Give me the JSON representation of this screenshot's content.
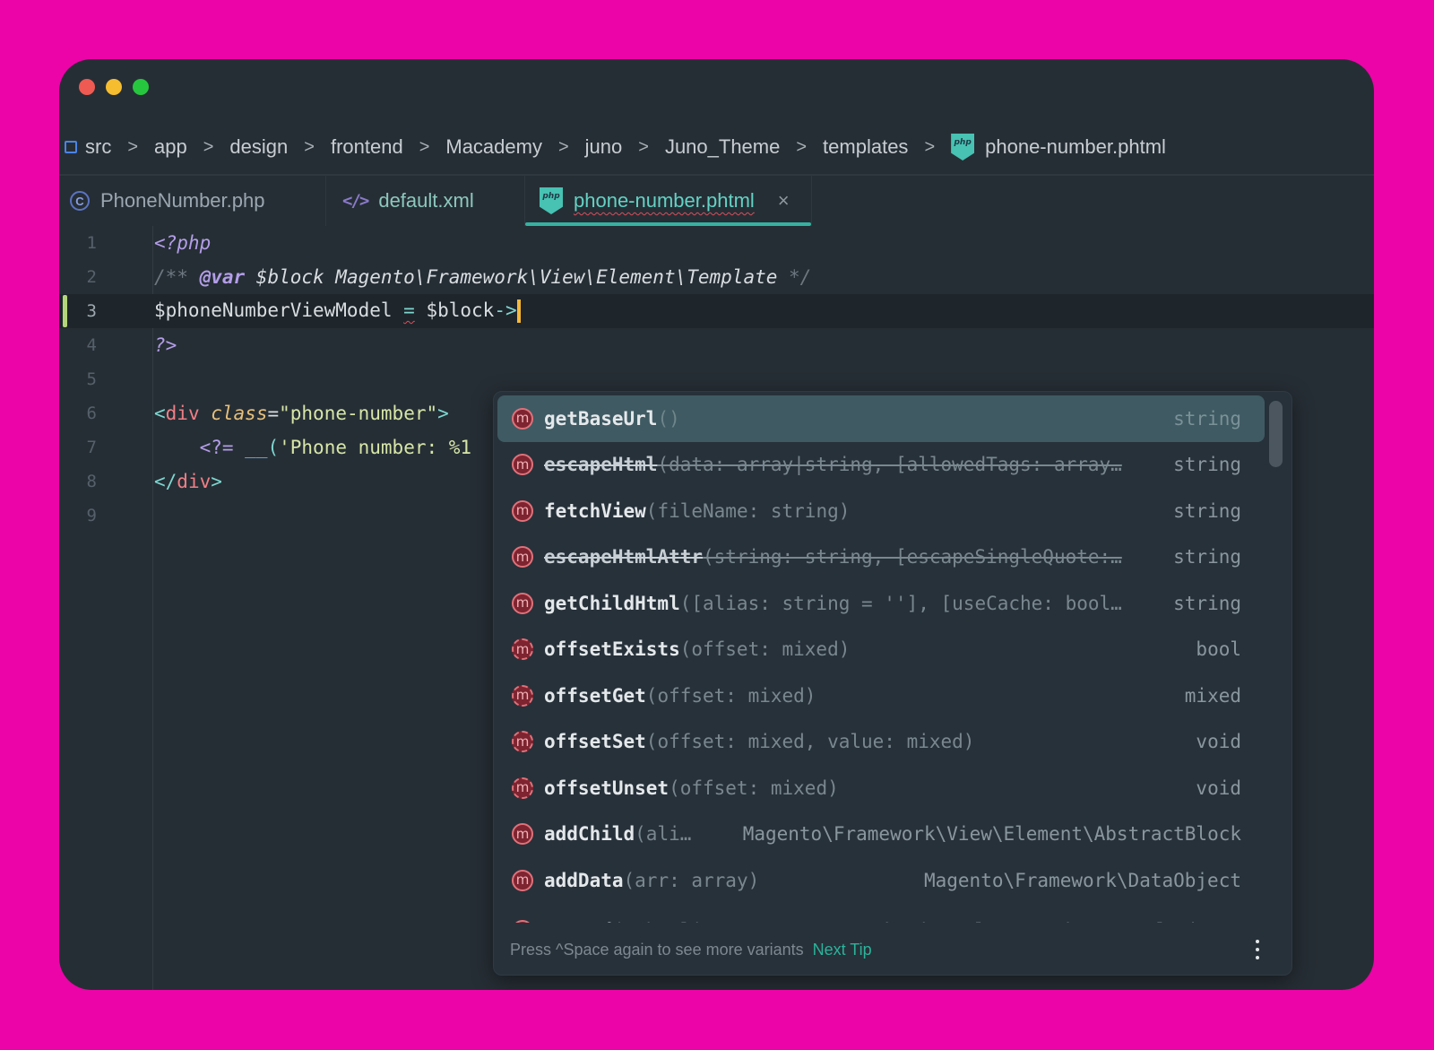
{
  "window": {
    "traffic_lights": [
      "close",
      "minimize",
      "zoom"
    ]
  },
  "breadcrumb": {
    "items": [
      "src",
      "app",
      "design",
      "frontend",
      "Macademy",
      "juno",
      "Juno_Theme",
      "templates",
      "phone-number.phtml"
    ],
    "separator": ">"
  },
  "tabs": [
    {
      "label": "PhoneNumber.php",
      "icon": "class-icon",
      "active": false
    },
    {
      "label": "default.xml",
      "icon": "xml-icon",
      "active": false
    },
    {
      "label": "phone-number.phtml",
      "icon": "php-icon",
      "active": true,
      "close": "×"
    }
  ],
  "editor": {
    "current_line": 3,
    "lines": [
      {
        "n": "1",
        "text": "<?php"
      },
      {
        "n": "2",
        "parts": [
          "/** ",
          "@var",
          " $block Magento\\Framework\\View\\Element\\Template",
          " */"
        ]
      },
      {
        "n": "3",
        "parts": [
          "$phoneNumberViewModel ",
          "=",
          " $block",
          "->"
        ]
      },
      {
        "n": "4",
        "text": "?>"
      },
      {
        "n": "5",
        "text": ""
      },
      {
        "n": "6",
        "parts": [
          "<",
          "div",
          " ",
          "class",
          "=",
          "\"phone-number\"",
          ">"
        ]
      },
      {
        "n": "7",
        "parts": [
          "    ",
          "<?=",
          " ",
          "__",
          "(",
          "'Phone number: %1"
        ]
      },
      {
        "n": "8",
        "parts": [
          "</",
          "div",
          ">"
        ]
      },
      {
        "n": "9",
        "text": ""
      }
    ]
  },
  "completion": {
    "items": [
      {
        "name": "getBaseUrl",
        "params": "()",
        "type": "string",
        "selected": true,
        "deprecated": false,
        "abstract": false
      },
      {
        "name": "escapeHtml",
        "params": "(data: array|string, [allowedTags: array…",
        "type": "string",
        "selected": false,
        "deprecated": true,
        "abstract": false
      },
      {
        "name": "fetchView",
        "params": "(fileName: string)",
        "type": "string",
        "selected": false,
        "deprecated": false,
        "abstract": false
      },
      {
        "name": "escapeHtmlAttr",
        "params": "(string: string, [escapeSingleQuote:…",
        "type": "string",
        "selected": false,
        "deprecated": true,
        "abstract": false
      },
      {
        "name": "getChildHtml",
        "params": "([alias: string = ''], [useCache: bool…",
        "type": "string",
        "selected": false,
        "deprecated": false,
        "abstract": false
      },
      {
        "name": "offsetExists",
        "params": "(offset: mixed)",
        "type": "bool",
        "selected": false,
        "deprecated": false,
        "abstract": true
      },
      {
        "name": "offsetGet",
        "params": "(offset: mixed)",
        "type": "mixed",
        "selected": false,
        "deprecated": false,
        "abstract": true
      },
      {
        "name": "offsetSet",
        "params": "(offset: mixed, value: mixed)",
        "type": "void",
        "selected": false,
        "deprecated": false,
        "abstract": true
      },
      {
        "name": "offsetUnset",
        "params": "(offset: mixed)",
        "type": "void",
        "selected": false,
        "deprecated": false,
        "abstract": true
      },
      {
        "name": "addChild",
        "params": "(ali…",
        "type": "Magento\\Framework\\View\\Element\\AbstractBlock",
        "selected": false,
        "deprecated": false,
        "abstract": false
      },
      {
        "name": "addData",
        "params": "(arr: array)",
        "type": "Magento\\Framework\\DataObject",
        "selected": false,
        "deprecated": false,
        "abstract": false
      },
      {
        "name": "append",
        "params": "(… bool|Magento\\Framework\\View\\Element\\AbstractBlock",
        "type": "",
        "selected": false,
        "deprecated": false,
        "abstract": false,
        "partial": true
      }
    ],
    "method_icon_letter": "m",
    "footer": {
      "hint": "Press ^Space again to see more variants",
      "next_tip": "Next Tip",
      "menu_icon": "more-vertical-icon"
    }
  },
  "colors": {
    "background": "#ec04a8",
    "window": "#262e35",
    "accent": "#36b2a0",
    "caret": "#f5b93a",
    "method_icon": "#e0717a"
  }
}
